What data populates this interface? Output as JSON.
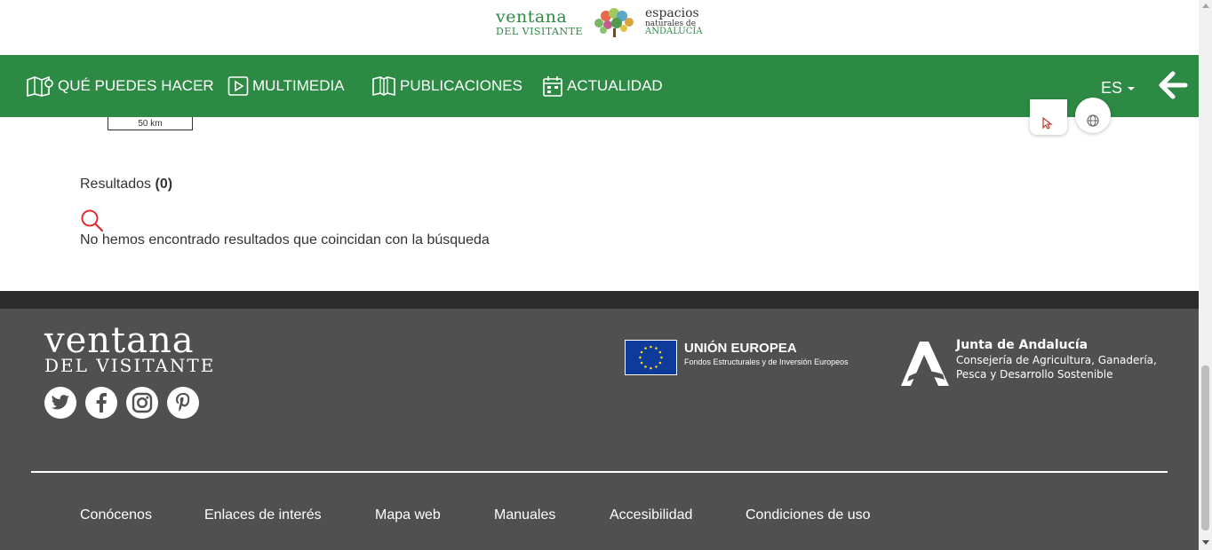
{
  "header": {
    "logo_main": "ventana",
    "logo_sub": "DEL VISITANTE",
    "partner_line1": "espacios",
    "partner_line2": "naturales de",
    "partner_line3": "ANDALUCÍA"
  },
  "nav": {
    "items": [
      {
        "label": "QUÉ PUEDES HACER",
        "icon": "map-icon"
      },
      {
        "label": "MULTIMEDIA",
        "icon": "play-icon"
      },
      {
        "label": "PUBLICACIONES",
        "icon": "book-icon"
      },
      {
        "label": "ACTUALIDAD",
        "icon": "calendar-icon"
      }
    ],
    "language": "ES",
    "back_icon": "arrow-left-icon"
  },
  "map": {
    "scale_label": "50 km"
  },
  "results": {
    "label": "Resultados",
    "count": "(0)",
    "empty_message": "No hemos encontrado resultados que coincidan con la búsqueda",
    "icon": "search-icon"
  },
  "footer": {
    "logo_main": "ventana",
    "logo_sub": "DEL VISITANTE",
    "social": [
      "twitter-icon",
      "facebook-icon",
      "instagram-icon",
      "pinterest-icon"
    ],
    "eu_title": "UNIÓN EUROPEA",
    "eu_subtitle": "Fondos Estructurales y de Inversión Europeos",
    "ja_title": "Junta de Andalucía",
    "ja_line1": "Consejería de Agricultura, Ganadería,",
    "ja_line2": "Pesca y Desarrollo Sostenible",
    "links": [
      "Conócenos",
      "Enlaces de interés",
      "Mapa web",
      "Manuales",
      "Accesibilidad",
      "Condiciones de uso"
    ]
  },
  "colors": {
    "nav_green": "#2d8a44",
    "footer_gray": "#505050",
    "search_red": "#d9302c"
  }
}
